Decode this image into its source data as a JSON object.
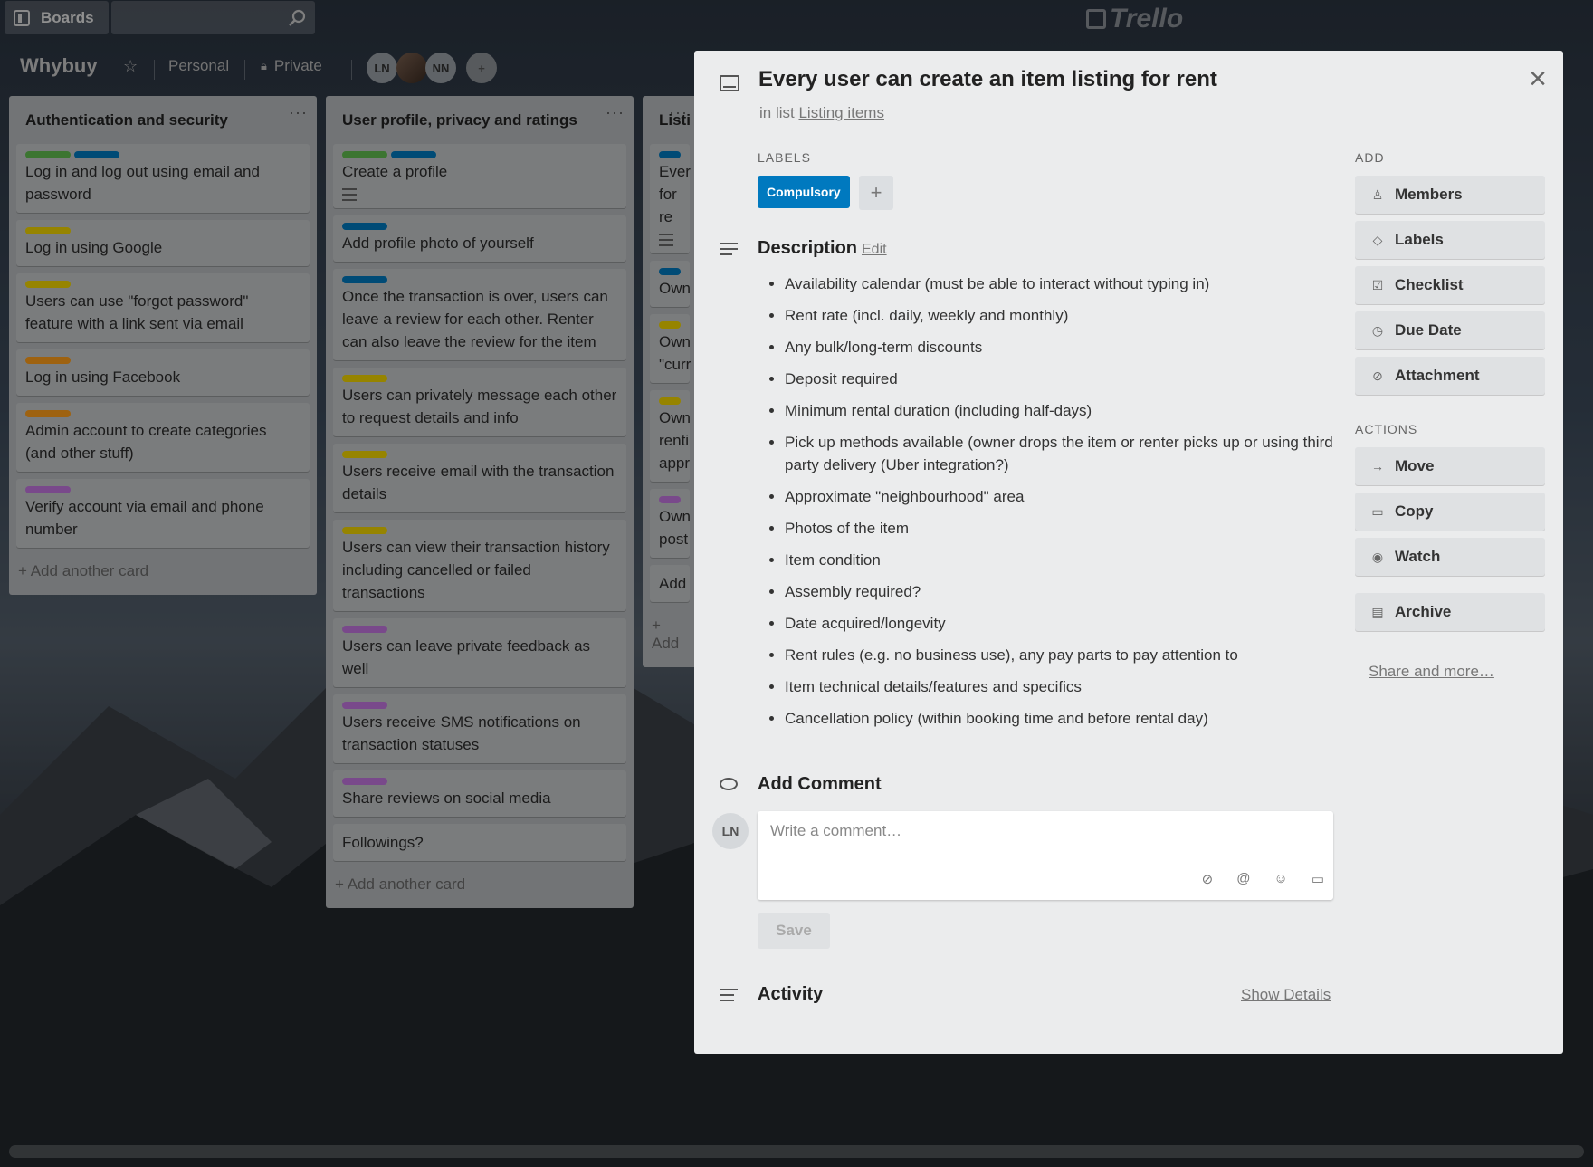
{
  "header": {
    "boards_label": "Boards",
    "search_value": "",
    "logo_text": "Trello"
  },
  "board": {
    "title": "Whybuy",
    "team": "Personal",
    "visibility": "Private",
    "members": [
      "LN",
      "",
      "NN"
    ]
  },
  "lists": [
    {
      "title": "Authentication and security",
      "cards": [
        {
          "labels": [
            "#61bd4f",
            "#0079bf"
          ],
          "text": "Log in and log out using email and password"
        },
        {
          "labels": [
            "#f2d600"
          ],
          "text": "Log in using Google"
        },
        {
          "labels": [
            "#f2d600"
          ],
          "text": "Users can use \"forgot password\" feature with a link sent via email"
        },
        {
          "labels": [
            "#ff9f1a"
          ],
          "text": "Log in using Facebook"
        },
        {
          "labels": [
            "#ff9f1a"
          ],
          "text": "Admin account to create categories (and other stuff)"
        },
        {
          "labels": [
            "#c377e0"
          ],
          "text": "Verify account via email and phone number"
        }
      ],
      "add_card": "Add another card"
    },
    {
      "title": "User profile, privacy and ratings",
      "cards": [
        {
          "labels": [
            "#61bd4f",
            "#0079bf"
          ],
          "text": "Create a profile",
          "desc": true
        },
        {
          "labels": [
            "#0079bf"
          ],
          "text": "Add profile photo of yourself"
        },
        {
          "labels": [
            "#0079bf"
          ],
          "text": "Once the transaction is over, users can leave a review for each other. Renter can also leave the review for the item"
        },
        {
          "labels": [
            "#f2d600"
          ],
          "text": "Users can privately message each other to request details and info"
        },
        {
          "labels": [
            "#f2d600"
          ],
          "text": "Users receive email with the transaction details"
        },
        {
          "labels": [
            "#f2d600"
          ],
          "text": "Users can view their transaction history including cancelled or failed transactions"
        },
        {
          "labels": [
            "#c377e0"
          ],
          "text": "Users can leave private feedback as well"
        },
        {
          "labels": [
            "#c377e0"
          ],
          "text": "Users receive SMS notifications on transaction statuses"
        },
        {
          "labels": [
            "#c377e0"
          ],
          "text": "Share reviews on social media"
        },
        {
          "labels": [],
          "text": "Followings?"
        }
      ],
      "add_card": "Add another card"
    },
    {
      "title": "Listi",
      "cards": [
        {
          "labels": [
            "#0079bf"
          ],
          "text": "Ever\nfor re",
          "desc": true
        },
        {
          "labels": [
            "#0079bf"
          ],
          "text": "Own"
        },
        {
          "labels": [
            "#f2d600"
          ],
          "text": "Own\n\"curr"
        },
        {
          "labels": [
            "#f2d600"
          ],
          "text": "Own\nrenti\nappr"
        },
        {
          "labels": [
            "#c377e0"
          ],
          "text": "Own\npost"
        },
        {
          "labels": [],
          "text": "Add"
        }
      ],
      "add_card": "Add"
    }
  ],
  "modal": {
    "title": "Every user can create an item listing for rent",
    "in_list_prefix": "in list",
    "list_name": "Listing items",
    "labels_heading": "LABELS",
    "label_chip": "Compulsory",
    "label_add": "+",
    "description_heading": "Description",
    "edit_link": "Edit",
    "description_items": [
      "Availability calendar (must be able to interact without typing in)",
      "Rent rate (incl. daily, weekly and monthly)",
      "Any bulk/long-term discounts",
      "Deposit required",
      "Minimum rental duration (including half-days)",
      "Pick up methods available (owner drops the item or renter picks up or using third party delivery (Uber integration?)",
      "Approximate \"neighbourhood\" area",
      "Photos of the item",
      "Item condition",
      "Assembly required?",
      "Date acquired/longevity",
      "Rent rules (e.g. no business use), any pay parts to pay attention to",
      "Item technical details/features and specifics",
      "Cancellation policy (within booking time and before rental day)"
    ],
    "comment_heading": "Add Comment",
    "comment_avatar": "LN",
    "comment_placeholder": "Write a comment…",
    "save_label": "Save",
    "activity_heading": "Activity",
    "show_details": "Show Details",
    "add_heading": "ADD",
    "add_buttons": [
      "Members",
      "Labels",
      "Checklist",
      "Due Date",
      "Attachment"
    ],
    "actions_heading": "ACTIONS",
    "action_buttons": [
      "Move",
      "Copy",
      "Watch"
    ],
    "archive_label": "Archive",
    "share_more": "Share and more…"
  }
}
